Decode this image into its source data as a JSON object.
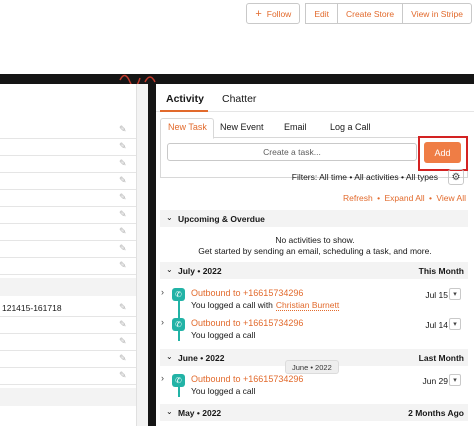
{
  "header": {
    "follow_label": "Follow",
    "edit_label": "Edit",
    "create_store_label": "Create Store",
    "view_in_stripe_label": "View in Stripe"
  },
  "left_panel": {
    "record_value": "121415-161718"
  },
  "tabs": {
    "activity": "Activity",
    "chatter": "Chatter"
  },
  "subtabs": {
    "new_task": "New Task",
    "new_event": "New Event",
    "email": "Email",
    "log_call": "Log a Call"
  },
  "composer": {
    "task_placeholder": "Create a task...",
    "add_label": "Add"
  },
  "filters": {
    "text": "Filters: All time • All activities • All types"
  },
  "links": {
    "refresh": "Refresh",
    "sep1": "•",
    "expand_all": "Expand All",
    "sep2": "•",
    "view_all": "View All"
  },
  "upcoming": {
    "title": "Upcoming & Overdue",
    "empty_line1": "No activities to show.",
    "empty_line2": "Get started by sending an email, scheduling a task, and more."
  },
  "sections": [
    {
      "title": "July • 2022",
      "right": "This Month",
      "items": [
        {
          "title": "Outbound to +16615734296",
          "subtitle": "You logged a call with",
          "name": "Christian Burnett",
          "date": "Jul 15"
        },
        {
          "title": "Outbound to +16615734296",
          "subtitle": "You logged a call",
          "date": "Jul 14"
        }
      ]
    },
    {
      "title": "June • 2022",
      "right": "Last Month",
      "items": [
        {
          "title": "Outbound to +16615734296",
          "subtitle": "You logged a call",
          "date": "Jun 29"
        }
      ]
    },
    {
      "title": "May • 2022",
      "right": "2 Months Ago"
    }
  ],
  "tooltip": "June • 2022",
  "colors": {
    "accent": "#e26a2c",
    "call_icon": "#22b3a6",
    "highlight_box": "#d32222"
  }
}
